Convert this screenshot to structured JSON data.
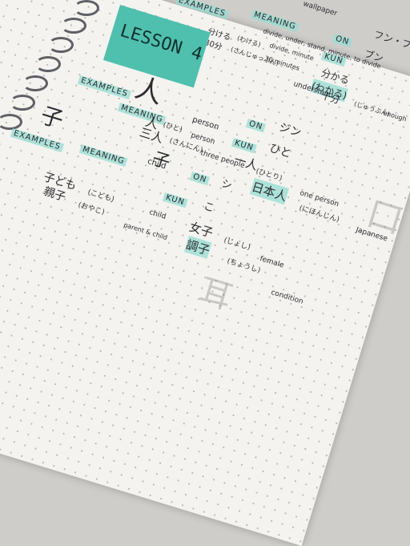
{
  "lesson_title": "LESSON 4",
  "top_fragment": {
    "examples_label": "EXAMPLES",
    "meaning_label": "MEANING",
    "on_label": "ON",
    "kun_label": "KUN",
    "line1": "分ける",
    "line1_kana": "(わける)",
    "line1_en": "divide, minute",
    "line2": "30分",
    "line2_kana": "(さんじゅっぷん)",
    "line2_en": "30 minutes",
    "meaning_text": "divide, under, stand, minute, to divide",
    "header_right": "wallpaper",
    "wakaru": "分かる",
    "wakaru_kana": "(わかる)",
    "wakaru_en": "understand",
    "jubun": "十分",
    "jubun_kana": "(じゅうぶん)",
    "jubun_en": "enough",
    "kun_kana": "ブン",
    "on_kana": "フン・ブ"
  },
  "hito": {
    "kanji": "人",
    "meaning_label": "MEANING",
    "meaning": "person",
    "on_label": "ON",
    "on_reading": "ジン",
    "kun_label": "KUN",
    "kun_reading": "ひと",
    "examples_label": "EXAMPLES",
    "ex1": "人",
    "ex1_kana": "(ひと)",
    "ex1_en": "person",
    "ex2": "三人",
    "ex2_kana": "(さんにん)",
    "ex2_en": "three people",
    "ex3": "一人",
    "ex3_kana": "(ひとり)",
    "ex3_en": "one person",
    "ex4": "日本人",
    "ex4_kana": "(にほんじん)",
    "ex4_en": "Japanese"
  },
  "ko": {
    "kanji": "子",
    "meaning_label": "MEANING",
    "meaning": "child",
    "on_label": "ON",
    "on_reading": "シ",
    "kun_label": "KUN",
    "kun_reading": "こ",
    "examples_label": "EXAMPLES",
    "ex1": "子ども",
    "ex1_kana": "(こども)",
    "ex1_en": "child",
    "ex2": "親子",
    "ex2_kana": "(おやこ)",
    "ex2_en": "parent & child",
    "ex3": "女子",
    "ex3_kana": "(じょし)",
    "ex3_en": "female",
    "ex4": "調子",
    "ex4_kana": "(ちょうし)",
    "ex4_en": "condition"
  },
  "colors": {
    "highlight": "#96dcd2",
    "lesson_box": "#4fbfae",
    "ink": "#2d2d33",
    "paper": "#f4f3ef"
  }
}
